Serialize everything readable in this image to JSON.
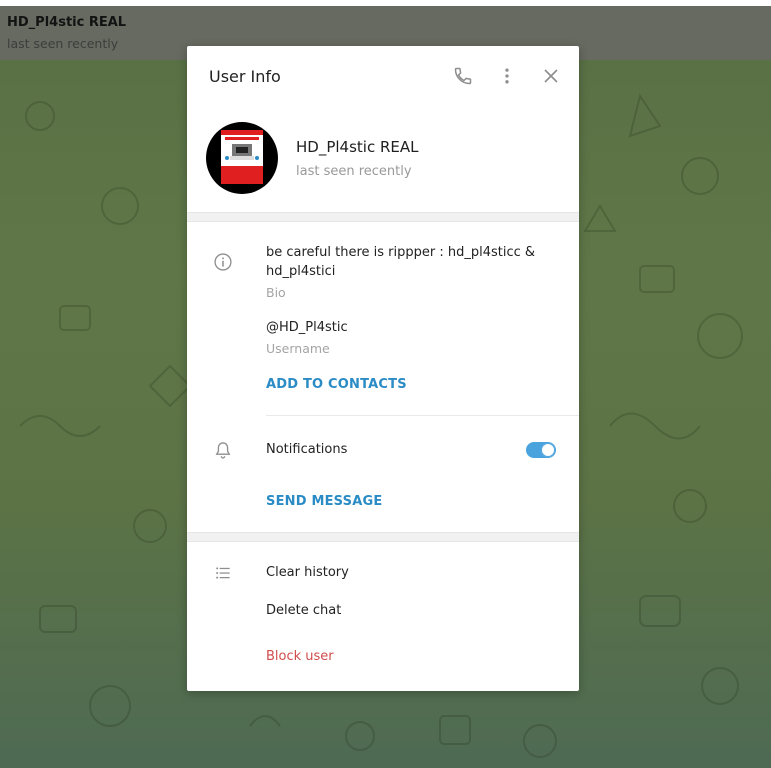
{
  "chat": {
    "title": "HD_Pl4stic REAL",
    "status": "last seen recently"
  },
  "modal": {
    "title": "User Info",
    "header_icons": [
      "phone-icon",
      "more-vertical-icon",
      "close-icon"
    ],
    "profile": {
      "name": "HD_Pl4stic REAL",
      "status": "last seen recently",
      "avatar_icon": "avatar-image"
    },
    "info": {
      "icon": "info-icon",
      "bio": "be careful there is rippper : hd_pl4sticc & hd_pl4stici",
      "bio_label": "Bio",
      "username": "@HD_Pl4stic",
      "username_label": "Username",
      "add_to_contacts": "ADD TO CONTACTS"
    },
    "notifications": {
      "icon": "bell-icon",
      "label": "Notifications",
      "enabled": true,
      "send_message": "SEND MESSAGE"
    },
    "actions": {
      "icon": "list-icon",
      "clear_history": "Clear history",
      "delete_chat": "Delete chat",
      "block_user": "Block user"
    }
  },
  "colors": {
    "accent": "#2a8bc5",
    "toggle": "#4aa3dd",
    "danger": "#d14c4c",
    "header": "#666a60",
    "chat_bg": "#5c7346"
  }
}
